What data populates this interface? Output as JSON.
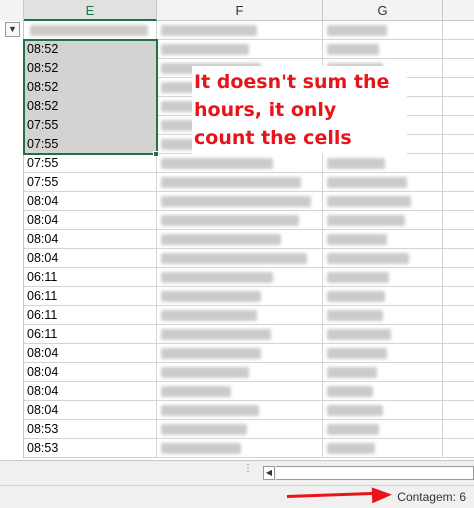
{
  "columns": [
    "E",
    "F",
    "G"
  ],
  "header_row_blurred": true,
  "times": [
    "08:52",
    "08:52",
    "08:52",
    "08:52",
    "07:55",
    "07:55",
    "07:55",
    "07:55",
    "08:04",
    "08:04",
    "08:04",
    "08:04",
    "06:11",
    "06:11",
    "06:11",
    "06:11",
    "08:04",
    "08:04",
    "08:04",
    "08:04",
    "08:53",
    "08:53"
  ],
  "selected_count": 6,
  "annotation": {
    "line1": "It doesn't sum the",
    "line2": "hours, it only",
    "line3": "count the cells"
  },
  "status": {
    "count_text": "Contagem: 6"
  },
  "colors": {
    "accent": "#217346",
    "annotation": "#e8141a",
    "selection_fill": "#d3d3d3"
  },
  "icons": {
    "filter": "filter-dropdown-icon",
    "scroll_left": "scroll-left-arrow-icon",
    "split": "split-handle-icon",
    "arrow": "red-arrow-annotation"
  }
}
